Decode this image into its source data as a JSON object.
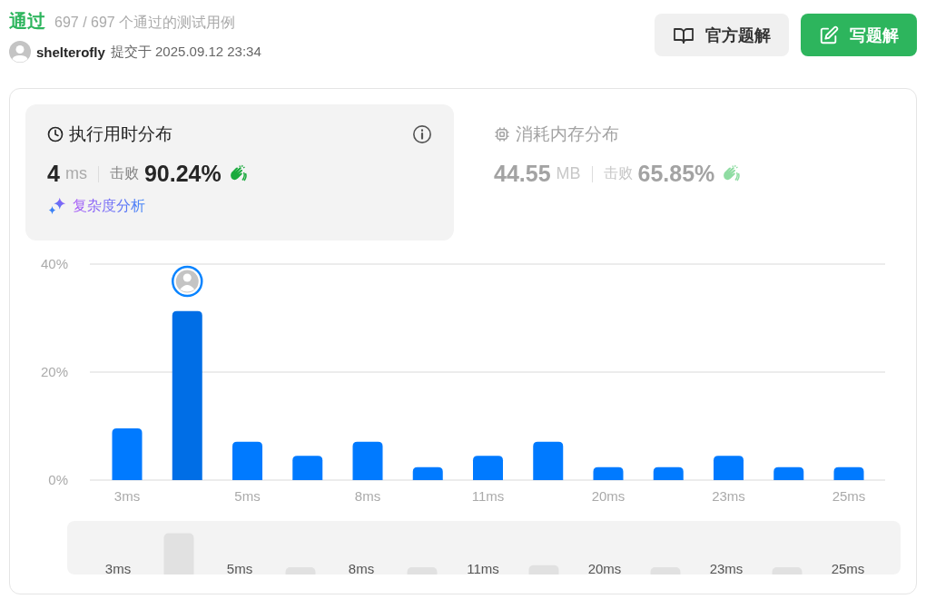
{
  "verdict": {
    "status": "通过",
    "tests": "697 / 697 个通过的测试用例"
  },
  "submission": {
    "user": "shelterofly",
    "submitted": "提交于 2025.09.12 23:34"
  },
  "buttons": [
    {
      "kind": "solution",
      "label": "官方题解"
    },
    {
      "kind": "write",
      "label": "写题解"
    }
  ],
  "tabs": [
    {
      "kind": "runtime",
      "title": "执行用时分布",
      "value": "4",
      "unit": "ms",
      "beats_label": "击败",
      "beats": "90.24%",
      "selected": true,
      "link": "复杂度分析"
    },
    {
      "kind": "memory",
      "title": "消耗内存分布",
      "value": "44.55",
      "unit": "MB",
      "beats_label": "击败",
      "beats": "65.85%",
      "selected": false
    }
  ],
  "chart": {
    "bars": [
      {
        "selected": false
      },
      {
        "selected": true
      },
      {
        "selected": false
      },
      {
        "selected": false
      },
      {
        "selected": false
      },
      {
        "selected": false
      },
      {
        "selected": false
      },
      {
        "selected": false
      },
      {
        "selected": false
      },
      {
        "selected": false
      },
      {
        "selected": false
      },
      {
        "selected": false
      },
      {
        "selected": false
      }
    ],
    "chart_data": {
      "type": "bar",
      "categories": [
        "3ms",
        null,
        "5ms",
        null,
        "8ms",
        null,
        "11ms",
        null,
        "20ms",
        null,
        "23ms",
        null,
        "25ms"
      ],
      "values": [
        9.6,
        31.3,
        7.1,
        4.5,
        7.1,
        2.4,
        4.5,
        7.1,
        2.4,
        2.4,
        4.5,
        2.4,
        2.4
      ],
      "ylim": [
        0,
        40
      ],
      "yticks": [
        {
          "value": 0,
          "label": "0%"
        },
        {
          "value": 20,
          "label": "20%"
        },
        {
          "value": 40,
          "label": "40%"
        }
      ]
    }
  },
  "overview": {
    "labels": [
      "3ms",
      "5ms",
      "8ms",
      "11ms",
      "20ms",
      "23ms",
      "25ms"
    ]
  }
}
